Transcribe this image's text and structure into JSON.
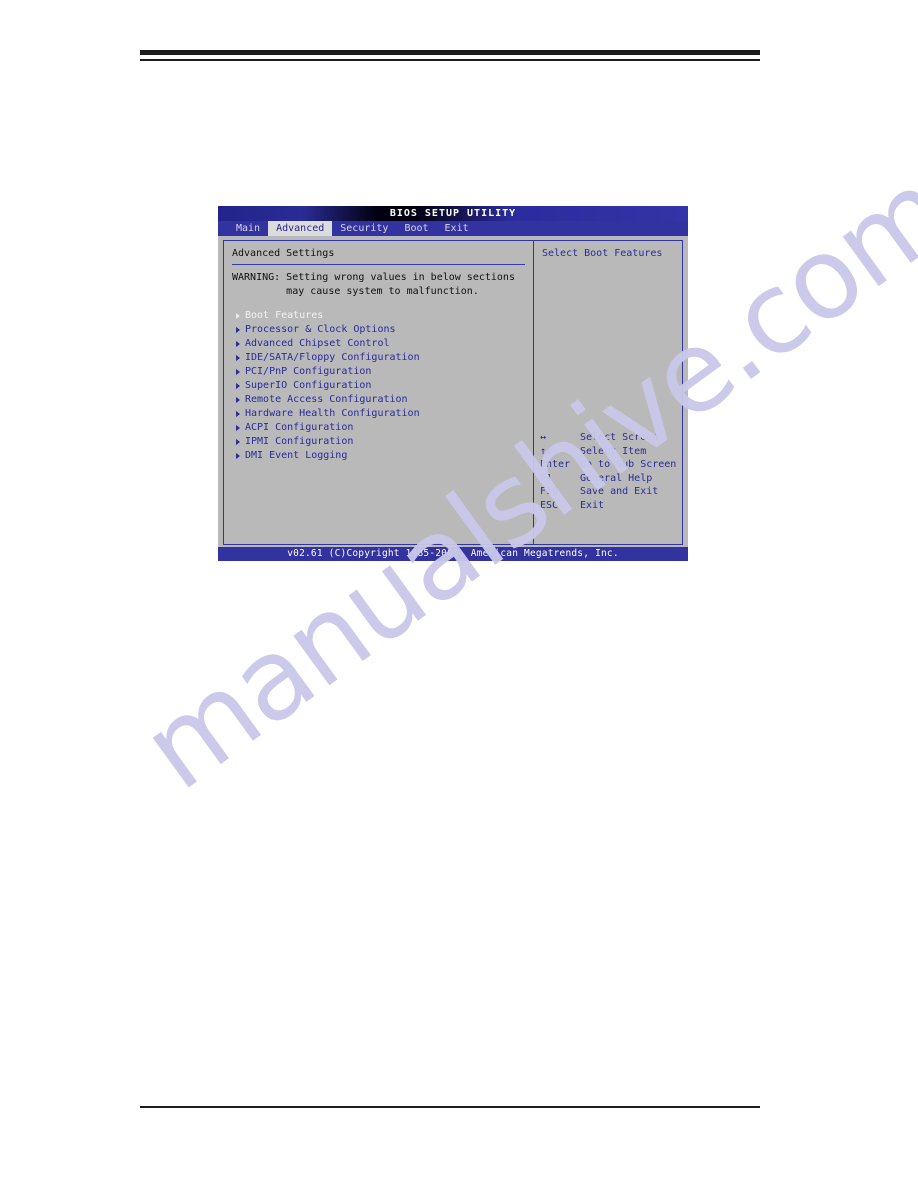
{
  "bios": {
    "title": "BIOS SETUP UTILITY",
    "tabs": [
      {
        "label": "Main",
        "active": false
      },
      {
        "label": "Advanced",
        "active": true
      },
      {
        "label": "Security",
        "active": false
      },
      {
        "label": "Boot",
        "active": false
      },
      {
        "label": "Exit",
        "active": false
      }
    ],
    "panel_title": "Advanced Settings",
    "warning": "WARNING: Setting wrong values in below sections\n         may cause system to malfunction.",
    "menu_items": [
      {
        "label": "Boot Features",
        "selected": true
      },
      {
        "label": "Processor & Clock Options",
        "selected": false
      },
      {
        "label": "Advanced Chipset Control",
        "selected": false
      },
      {
        "label": "IDE/SATA/Floppy Configuration",
        "selected": false
      },
      {
        "label": "PCI/PnP Configuration",
        "selected": false
      },
      {
        "label": "SuperIO Configuration",
        "selected": false
      },
      {
        "label": "Remote Access Configuration",
        "selected": false
      },
      {
        "label": "Hardware Health Configuration",
        "selected": false
      },
      {
        "label": "ACPI Configuration",
        "selected": false
      },
      {
        "label": "IPMI Configuration",
        "selected": false
      },
      {
        "label": "DMI Event Logging",
        "selected": false
      }
    ],
    "help_title": "Select Boot Features",
    "legend": [
      {
        "key": "↔",
        "desc": "Select Screen"
      },
      {
        "key": "↑↓",
        "desc": "Select Item"
      },
      {
        "key": "Enter",
        "desc": "Go to Sub Screen"
      },
      {
        "key": "F1",
        "desc": "General Help"
      },
      {
        "key": "F10",
        "desc": "Save and Exit"
      },
      {
        "key": "ESC",
        "desc": "Exit"
      }
    ],
    "footer": "v02.61 (C)Copyright 1985-2006, American Megatrends, Inc."
  },
  "page": {
    "watermark": "manualshive.com"
  },
  "colors": {
    "menubar_blue": "#3232a0",
    "text_blue": "#2a2a9c",
    "screen_gray": "#b9b9b9",
    "watermark_purple": "#c9c8ea"
  }
}
